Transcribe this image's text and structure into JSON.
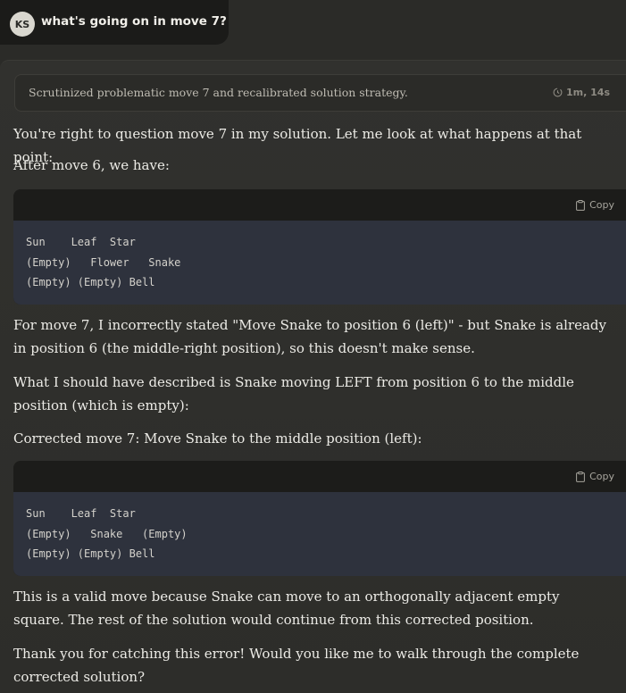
{
  "user": {
    "avatar_initials": "KS",
    "message": "what's going on in move 7?"
  },
  "thinking": {
    "summary": "Scrutinized problematic move 7 and recalibrated solution strategy.",
    "duration": "1m, 14s"
  },
  "response": {
    "p1": "You're right to question move 7 in my solution. Let me look at what happens at that point:",
    "p2": "After move 6, we have:",
    "code1": {
      "copy_label": "Copy",
      "lines": [
        "Sun    Leaf  Star",
        "(Empty)   Flower   Snake",
        "(Empty) (Empty) Bell"
      ]
    },
    "p3": "For move 7, I incorrectly stated \"Move Snake to position 6 (left)\" - but Snake is already in position 6 (the middle-right position), so this doesn't make sense.",
    "p4": "What I should have described is Snake moving LEFT from position 6 to the middle position (which is empty):",
    "p5": "Corrected move 7: Move Snake to the middle position (left):",
    "code2": {
      "copy_label": "Copy",
      "lines": [
        "Sun    Leaf  Star",
        "(Empty)   Snake   (Empty)",
        "(Empty) (Empty) Bell"
      ]
    },
    "p6": "This is a valid move because Snake can move to an orthogonally adjacent empty square. The rest of the solution would continue from this corrected position.",
    "p7": "Thank you for catching this error! Would you like me to walk through the complete corrected solution?"
  }
}
